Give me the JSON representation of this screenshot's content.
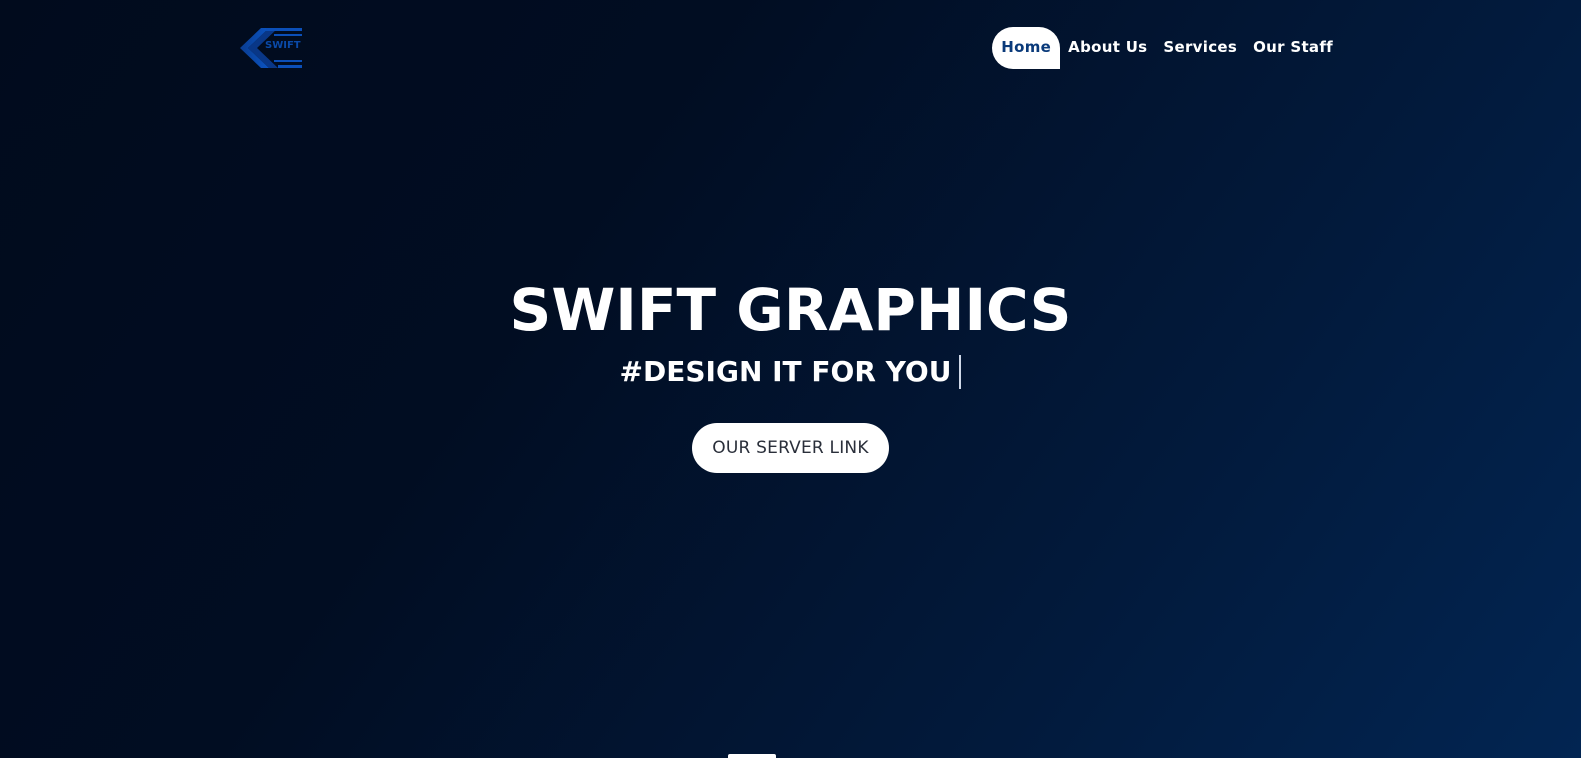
{
  "brand": {
    "logo_text": "SWIFT",
    "logo_icon": "chevron-left-logo",
    "accent": "#0a4aa8"
  },
  "nav": {
    "items": [
      {
        "label": "Home",
        "active": true
      },
      {
        "label": "About Us",
        "active": false
      },
      {
        "label": "Services",
        "active": false
      },
      {
        "label": "Our Staff",
        "active": false
      }
    ]
  },
  "hero": {
    "title": "SWIFT GRAPHICS",
    "subtitle": "#DESIGN IT FOR YOU",
    "cta_label": "OUR SERVER LINK"
  },
  "colors": {
    "background_start": "#010b1d",
    "background_end": "#022552",
    "active_nav_text": "#0a3a7a"
  }
}
